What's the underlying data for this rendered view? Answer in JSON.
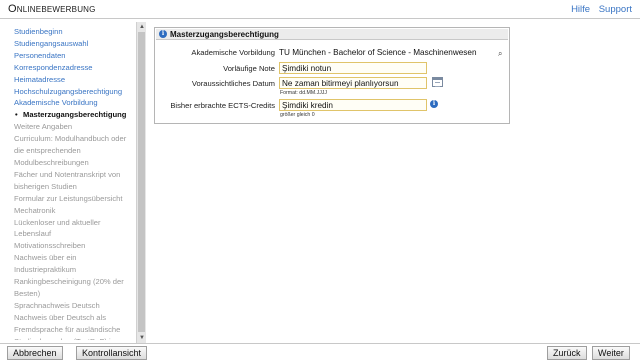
{
  "header": {
    "title": "Onlinebewerbung",
    "links": [
      "Hilfe",
      "Support"
    ]
  },
  "sidebar": {
    "items": [
      {
        "label": "Studienbeginn",
        "state": "link"
      },
      {
        "label": "Studiengangsauswahl",
        "state": "link"
      },
      {
        "label": "Personendaten",
        "state": "link"
      },
      {
        "label": "Korrespondenzadresse",
        "state": "link"
      },
      {
        "label": "Heimatadresse",
        "state": "link"
      },
      {
        "label": "Hochschulzugangsberechtigung",
        "state": "link"
      },
      {
        "label": "Akademische Vorbildung",
        "state": "link"
      },
      {
        "label": "Masterzugangsberechtigung",
        "state": "active"
      },
      {
        "label": "Weitere Angaben",
        "state": "disabled"
      },
      {
        "label": "Curriculum: Modulhandbuch oder die entsprechenden Modulbeschreibungen",
        "state": "disabled"
      },
      {
        "label": "Fächer und Notentranskript von bisherigen Studien",
        "state": "disabled"
      },
      {
        "label": "Formular zur Leistungsübersicht Mechatronik",
        "state": "disabled"
      },
      {
        "label": "Lückenloser und aktueller Lebenslauf",
        "state": "disabled"
      },
      {
        "label": "Motivationsschreiben",
        "state": "disabled"
      },
      {
        "label": "Nachweis über ein Industriepraktikum",
        "state": "disabled"
      },
      {
        "label": "Rankingbescheinigung (20% der Besten)",
        "state": "disabled"
      },
      {
        "label": "Sprachnachweis Deutsch",
        "state": "disabled"
      },
      {
        "label": "Nachweis über Deutsch als Fremdsprache für ausländische Studienbewerber (TestDaF) in",
        "state": "disabled"
      }
    ]
  },
  "panel": {
    "title": "Masterzugangsberechtigung",
    "fields": {
      "vorbildung": {
        "label": "Akademische Vorbildung",
        "value": "TU München - Bachelor of Science - Maschinenwesen"
      },
      "note": {
        "label": "Vorläufige Note",
        "value": "Şimdiki notun"
      },
      "datum": {
        "label": "Voraussichtliches Datum",
        "value": "Ne zaman bitirmeyi planlıyorsun",
        "hint": "Format: dd.MM.JJJJ"
      },
      "ects": {
        "label": "Bisher erbrachte ECTS-Credits",
        "value": "Şimdiki kredin",
        "hint": "größer gleich 0"
      }
    }
  },
  "footer": {
    "abbrechen": "Abbrechen",
    "kontrollansicht": "Kontrollansicht",
    "zurueck": "Zurück",
    "weiter": "Weiter"
  },
  "icons": {
    "info": "info-icon",
    "search": "magnifier-icon",
    "calendar": "calendar-icon"
  },
  "colors": {
    "link": "#3a75c4",
    "disabled": "#9a9a9a",
    "input_border": "#e0c46a",
    "info_icon": "#2d6cc0"
  }
}
